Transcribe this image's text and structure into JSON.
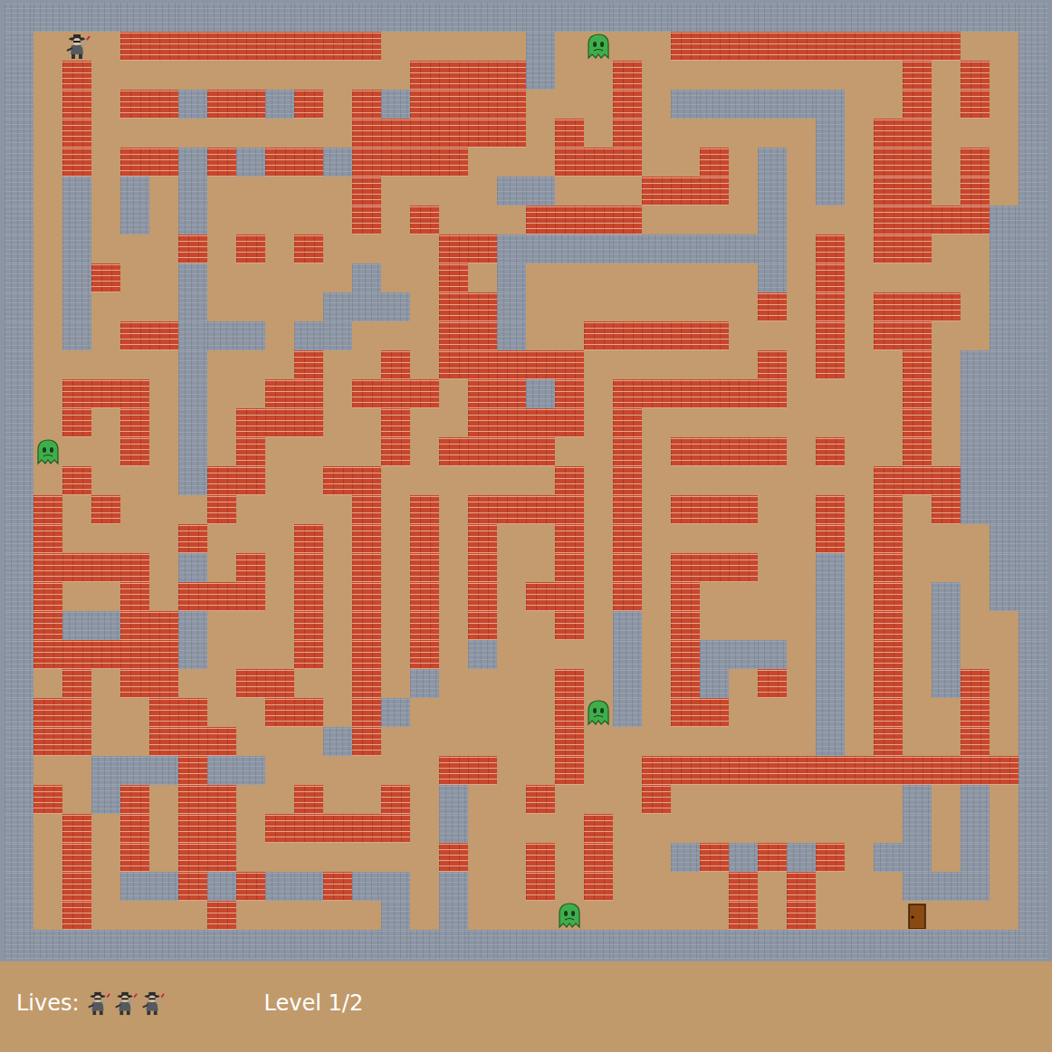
{
  "maze": {
    "rows": [
      "GGGGGGGGGGGGGGGGGGGGGGGGGGGGGGGGGGGG",
      "G.P.BBBBBBBBB.....G.E..BBBBBBBBBB..G",
      "G.B...........BBBBG..B.........B.B.G",
      "G.B.BBGBBGB.BGBBBB...B.GGGGGG..B.B.G",
      "G.B.........BBBBBB.B.B......G.BB...G",
      "G.B.BBGBGBBGBBBB...BBB..B.G.G.BB.B.G",
      "G.G.G.G.....B....GG...BBB.G.G.BB.B.G",
      "G.G.G.G.....B.B...BBBB....G...BBBBGG",
      "G.G...B.B.B....BBGGGGGGGGGG.B.BB..GG",
      "G.GB..G.....G..B.G........G.B.....GG",
      "G.G...G....GGG.BBG........B.B.BBB.GG",
      "G.G.BBGGG.GG...BBG..BBBBB...B.BB..GG",
      "G.....G...B..B.BBBBB......B.B..B.GGG",
      "G.BBB.G..BB.BBB.BBGB.BBBBBB....B.GGG",
      "G.B.B.G.BBB..B..BBBB.B.........B.GGG",
      "GE..B.G.B....B.BBBB..B.BBBB.B..B.GGG",
      "G.B...GBB..BB......B.B........BBBGGG",
      "GB.B...B....B.B.BBBB.B.BBB..B.B.BGGG",
      "GB....B...B.B.B.B..B.B......B.B...GG",
      "GBBBB.G.B.B.B.B.B..B.B.BBB..G.B...GG",
      "GB..B.BBB.B.B.B.B.BB.B.B....G.B.G.GG",
      "GBGGBBG...B.B.B.B..B.G.B....G.B.G..G",
      "GBBBBBG...B.B.B.G....G.BGGG.G.B.G..G",
      "G.B.BB..BB..B.G....B.G.BG.B.G.B.GB.G",
      "GBB..BB..BB.BG.....BEG.BB...G.B..B.G",
      "GBB..BBB...GB......B........G.B..B.G",
      "G..GGGBGG......BB..B..BBBBBBBBBBBBBG",
      "GB.GB.BB..B..B.G..B...B........G.G.G",
      "G.B.B.BB.BBBBB.G....B..........G.G.G",
      "G.B.B.BB.......B..B.B..GBGBGB.GG.G.G",
      "G.B.GGBGBGGBGG.G..B.B....B.B...GGG.G",
      "G.B....B.....G.G...E.....B.B...D...G",
      "GGGGGGGGGGGGGGGGGGGGGGGGGGGGGGGGGGGG"
    ]
  },
  "status_bar": {
    "lives_label": "Lives:",
    "lives": 3,
    "level": "Level 1/2"
  }
}
